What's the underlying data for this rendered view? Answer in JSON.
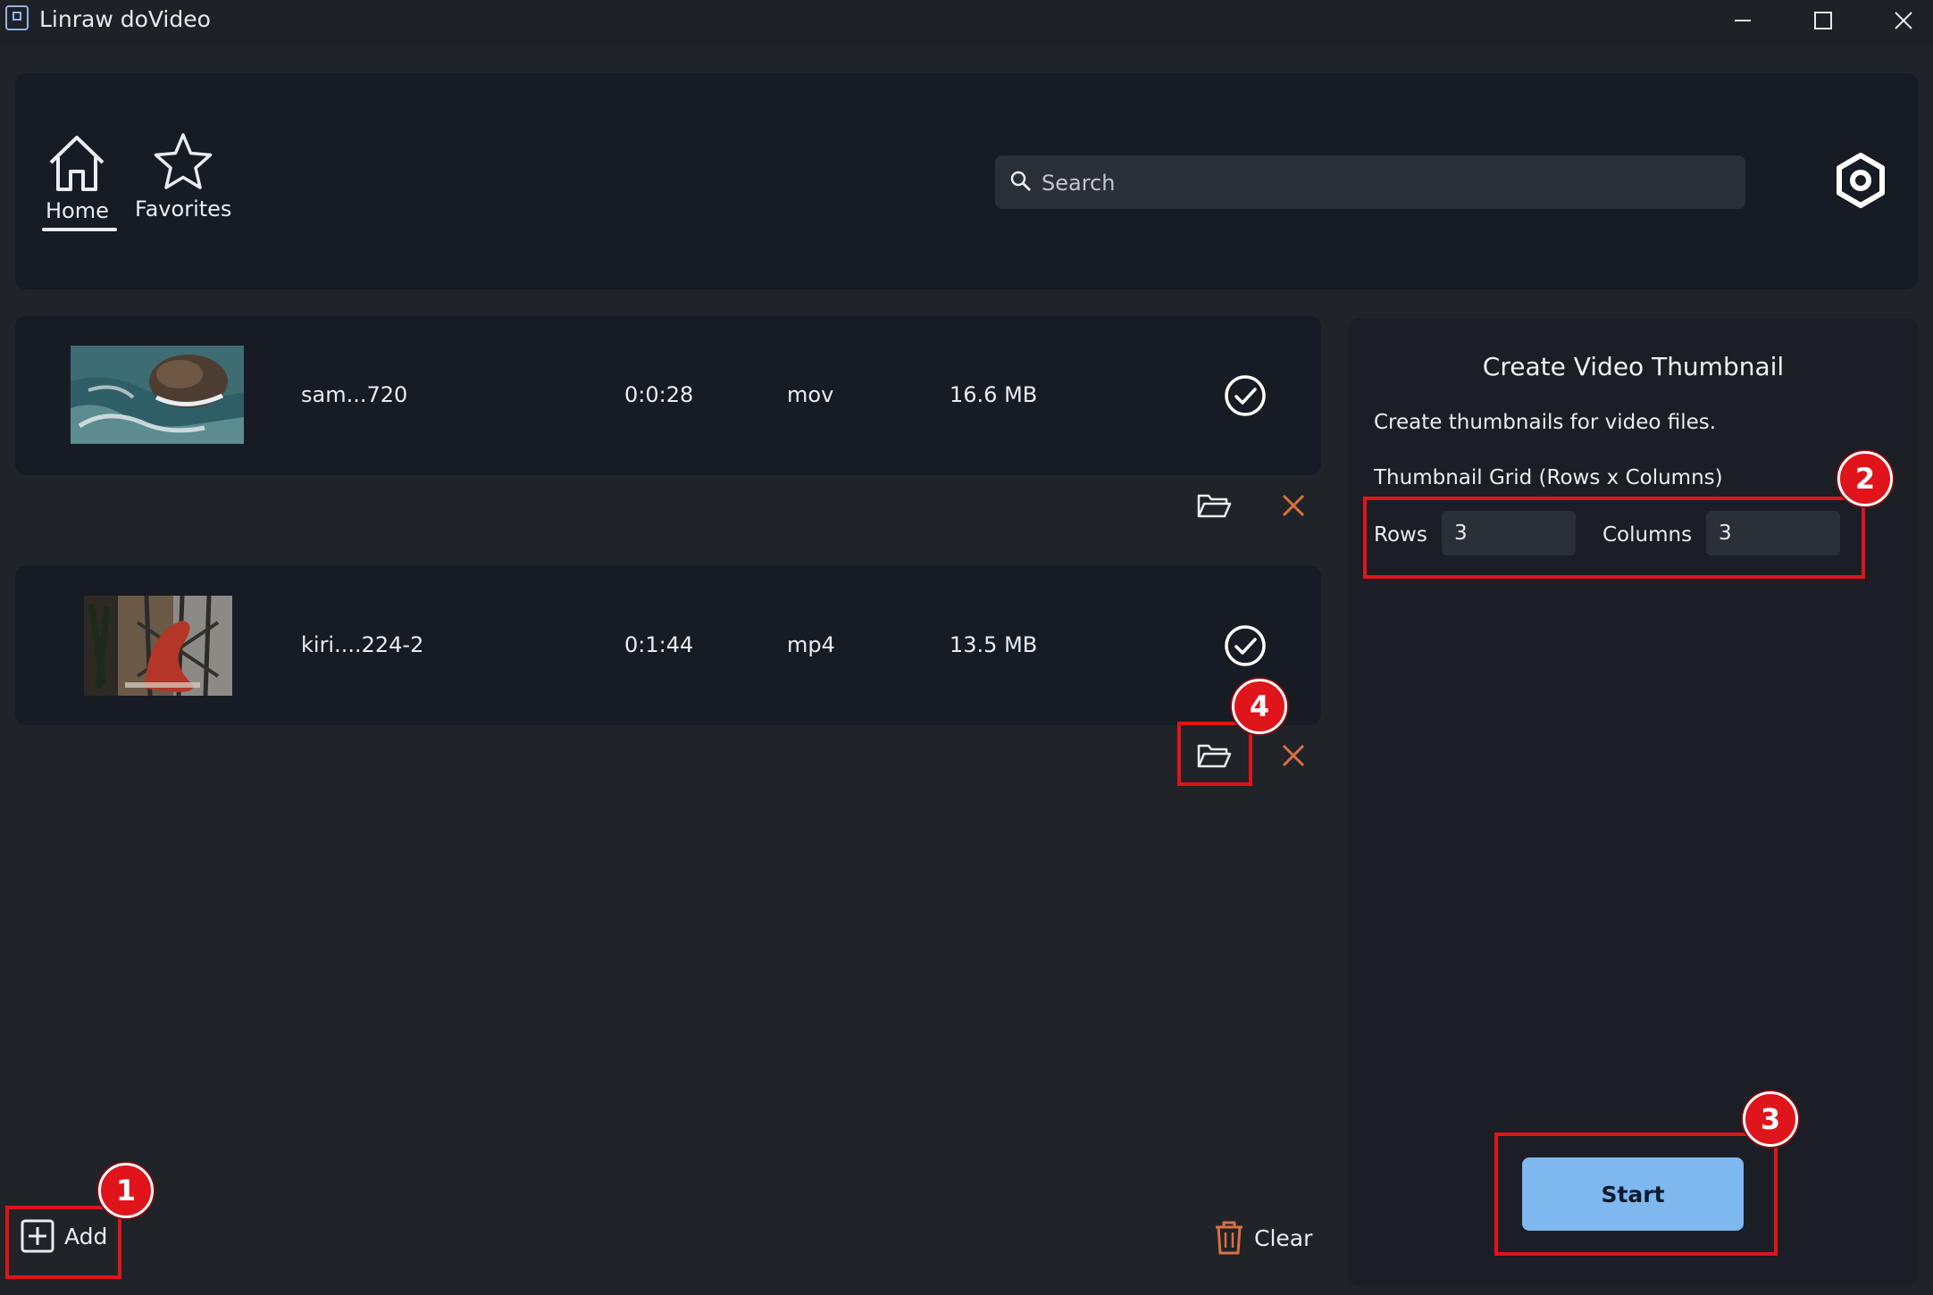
{
  "window": {
    "title": "Linraw doVideo"
  },
  "nav": {
    "items": [
      {
        "label": "Home",
        "icon": "home-icon",
        "active": true
      },
      {
        "label": "Favorites",
        "icon": "star-icon",
        "active": false
      }
    ]
  },
  "search": {
    "placeholder": "Search"
  },
  "files": [
    {
      "name": "sam...720",
      "duration": "0:0:28",
      "format": "mov",
      "size": "16.6 MB"
    },
    {
      "name": "kiri....224-2",
      "duration": "0:1:44",
      "format": "mp4",
      "size": "13.5 MB"
    }
  ],
  "panel": {
    "title": "Create Video Thumbnail",
    "description": "Create thumbnails for video files.",
    "grid_label": "Thumbnail Grid (Rows x Columns)",
    "rows_label": "Rows",
    "rows_value": "3",
    "columns_label": "Columns",
    "columns_value": "3",
    "start_label": "Start"
  },
  "footer": {
    "add_label": "Add",
    "clear_label": "Clear"
  },
  "annotations": {
    "m1": "1",
    "m2": "2",
    "m3": "3",
    "m4": "4"
  },
  "colors": {
    "accent": "#7fb8ee",
    "highlight": "#e0141b",
    "remove": "#d9713f"
  }
}
